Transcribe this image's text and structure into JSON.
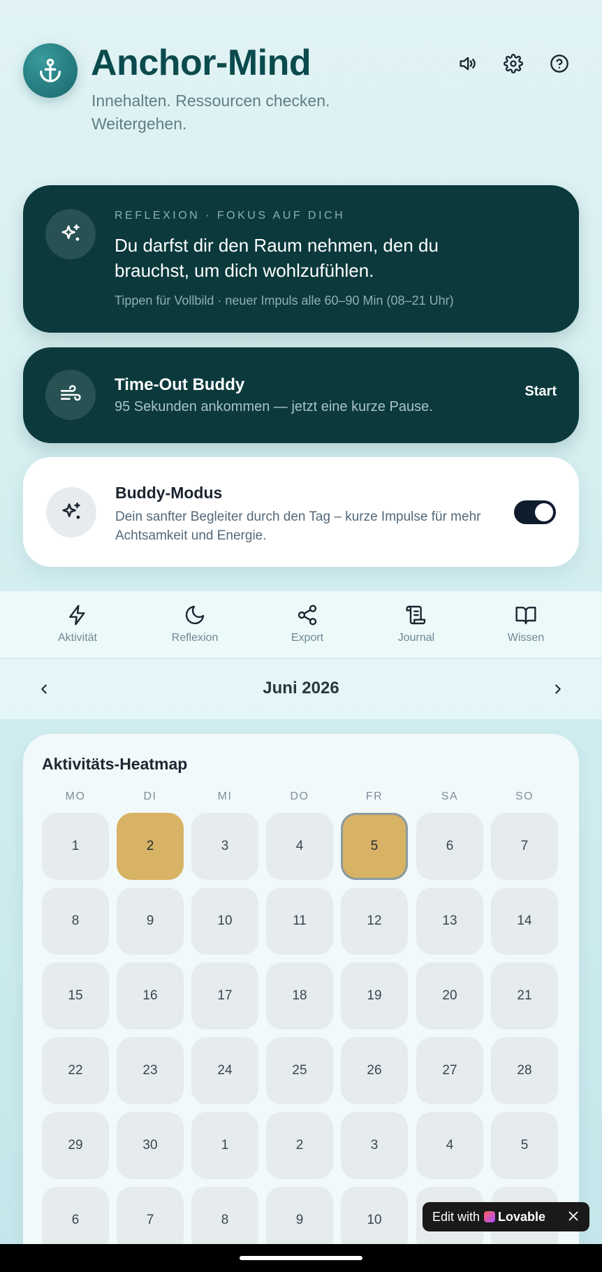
{
  "app": {
    "title": "Anchor-Mind",
    "tagline": "Innehalten. Ressourcen checken. Weitergehen."
  },
  "header_icons": [
    "speaker-icon",
    "gear-icon",
    "help-icon"
  ],
  "reflection": {
    "kicker": "Reflexion · Fokus auf dich",
    "quote": "Du darfst dir den Raum nehmen, den du brauchst, um dich wohlzufühlen.",
    "hint": "Tippen für Vollbild · neuer Impuls alle 60–90 Min (08–21 Uhr)"
  },
  "timeout_buddy": {
    "title": "Time-Out Buddy",
    "subtitle": "95 Sekunden ankommen — jetzt eine kurze Pause.",
    "start_label": "Start"
  },
  "buddy_mode": {
    "title": "Buddy-Modus",
    "description": "Dein sanfter Begleiter durch den Tag – kurze Impulse für mehr Achtsamkeit und Energie.",
    "enabled": true
  },
  "nav": [
    {
      "label": "Aktivität",
      "icon": "bolt-icon"
    },
    {
      "label": "Reflexion",
      "icon": "moon-icon"
    },
    {
      "label": "Export",
      "icon": "share-icon"
    },
    {
      "label": "Journal",
      "icon": "scroll-icon"
    },
    {
      "label": "Wissen",
      "icon": "book-icon"
    }
  ],
  "calendar": {
    "month_label": "Juni 2026",
    "heatmap_title": "Aktivitäts-Heatmap",
    "weekdays": [
      "MO",
      "DI",
      "MI",
      "DO",
      "FR",
      "SA",
      "SO"
    ],
    "weeks": [
      [
        "1",
        "2",
        "3",
        "4",
        "5",
        "6",
        "7"
      ],
      [
        "8",
        "9",
        "10",
        "11",
        "12",
        "13",
        "14"
      ],
      [
        "15",
        "16",
        "17",
        "18",
        "19",
        "20",
        "21"
      ],
      [
        "22",
        "23",
        "24",
        "25",
        "26",
        "27",
        "28"
      ],
      [
        "29",
        "30",
        "1",
        "2",
        "3",
        "4",
        "5"
      ],
      [
        "6",
        "7",
        "8",
        "9",
        "10",
        "11",
        "12"
      ]
    ],
    "active_days": [
      "2",
      "5"
    ],
    "today": "5",
    "active_color": "#d8b265"
  },
  "badge": {
    "prefix": "Edit with",
    "brand": "Lovable"
  }
}
